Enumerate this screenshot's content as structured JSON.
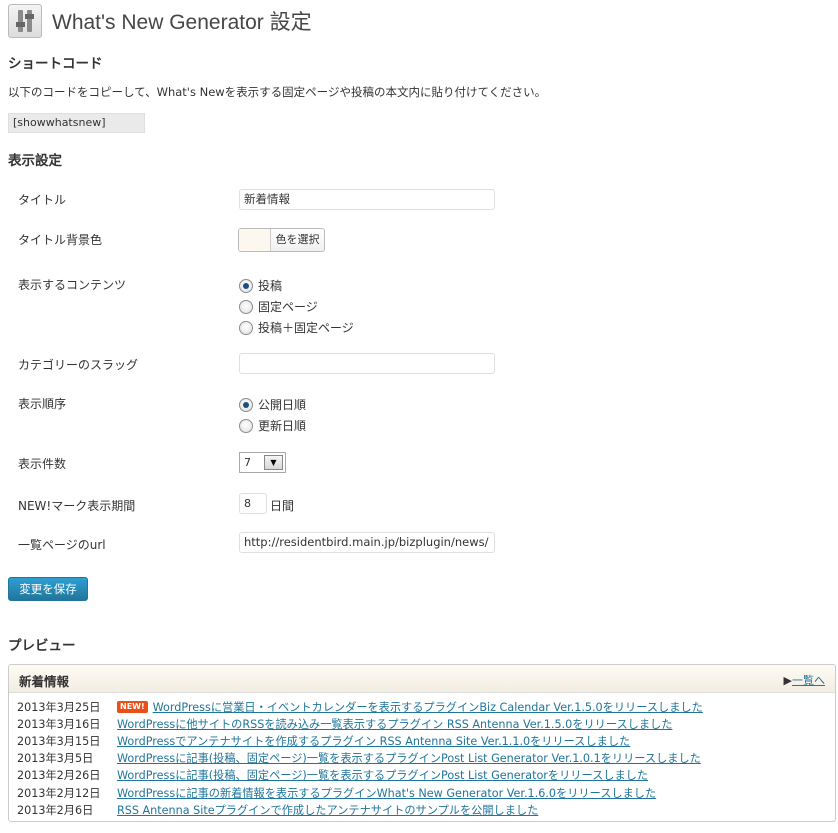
{
  "header": {
    "title": "What's New Generator 設定"
  },
  "shortcode": {
    "heading": "ショートコード",
    "description": "以下のコードをコピーして、What's Newを表示する固定ページや投稿の本文内に貼り付けてください。",
    "code": "[showwhatsnew]"
  },
  "settings": {
    "heading": "表示設定",
    "title_label": "タイトル",
    "title_value": "新着情報",
    "bgcolor_label": "タイトル背景色",
    "bgcolor_button": "色を選択",
    "bgcolor_value": "#fdf8ef",
    "content_label": "表示するコンテンツ",
    "content_options": [
      "投稿",
      "固定ページ",
      "投稿＋固定ページ"
    ],
    "slug_label": "カテゴリーのスラッグ",
    "slug_value": "",
    "order_label": "表示順序",
    "order_options": [
      "公開日順",
      "更新日順"
    ],
    "count_label": "表示件数",
    "count_value": "7",
    "newmark_label": "NEW!マーク表示期間",
    "newmark_value": "8",
    "newmark_suffix": "日間",
    "url_label": "一覧ページのurl",
    "url_value": "http://residentbird.main.jp/bizplugin/news/",
    "save_label": "変更を保存"
  },
  "preview": {
    "heading": "プレビュー",
    "box_title": "新着情報",
    "more_arrow": "▶",
    "more_label": "一覧へ",
    "new_badge": "NEW!",
    "items": [
      {
        "date": "2013年3月25日",
        "is_new": true,
        "text": "WordPressに営業日・イベントカレンダーを表示するプラグインBiz Calendar Ver.1.5.0をリリースしました"
      },
      {
        "date": "2013年3月16日",
        "is_new": false,
        "text": "WordPressに他サイトのRSSを読み込み一覧表示するプラグイン RSS Antenna Ver.1.5.0をリリースしました"
      },
      {
        "date": "2013年3月15日",
        "is_new": false,
        "text": "WordPressでアンテナサイトを作成するプラグイン RSS Antenna Site Ver.1.1.0をリリースしました"
      },
      {
        "date": "2013年3月5日",
        "is_new": false,
        "text": "WordPressに記事(投稿、固定ページ)一覧を表示するプラグインPost List Generator Ver.1.0.1をリリースしました"
      },
      {
        "date": "2013年2月26日",
        "is_new": false,
        "text": "WordPressに記事(投稿、固定ページ)一覧を表示するプラグインPost List Generatorをリリースしました"
      },
      {
        "date": "2013年2月12日",
        "is_new": false,
        "text": "WordPressに記事の新着情報を表示するプラグインWhat's New Generator Ver.1.6.0をリリースしました"
      },
      {
        "date": "2013年2月6日",
        "is_new": false,
        "text": "RSS Antenna Siteプラグインで作成したアンテナサイトのサンプルを公開しました"
      }
    ]
  },
  "colors": {
    "accent": "#21759b",
    "new_badge": "#e8501a"
  }
}
